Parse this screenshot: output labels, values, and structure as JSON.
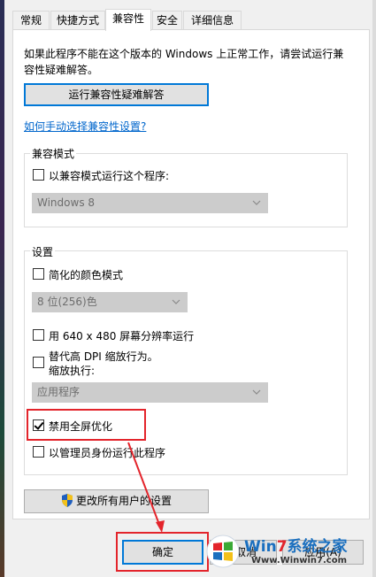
{
  "tabs": [
    {
      "label": "常规"
    },
    {
      "label": "快捷方式"
    },
    {
      "label": "兼容性"
    },
    {
      "label": "安全"
    },
    {
      "label": "详细信息"
    }
  ],
  "active_tab": "兼容性",
  "intro_text": "如果此程序不能在这个版本的 Windows 上正常工作，请尝试运行兼容性疑难解答。",
  "run_troubleshooter_button": "运行兼容性疑难解答",
  "manual_link": "如何手动选择兼容性设置?",
  "compat_mode": {
    "title": "兼容模式",
    "checkbox_label": "以兼容模式运行这个程序:",
    "checked": false,
    "select_value": "Windows 8"
  },
  "settings": {
    "title": "设置",
    "reduced_color": {
      "label": "简化的颜色模式",
      "checked": false
    },
    "color_select_value": "8 位(256)色",
    "run_640": {
      "label": "用 640 x 480 屏幕分辨率运行",
      "checked": false
    },
    "dpi_override": {
      "label_line1": "替代高 DPI 缩放行为。",
      "label_line2": "缩放执行:",
      "checked": false
    },
    "dpi_select_value": "应用程序",
    "disable_fullscreen": {
      "label": "禁用全屏优化",
      "checked": true
    },
    "run_as_admin": {
      "label": "以管理员身份运行此程序",
      "checked": false
    }
  },
  "change_all_users_button": "更改所有用户的设置",
  "footer": {
    "ok_label": "确定",
    "cancel_label": "取消",
    "apply_label": "应用(A)"
  },
  "watermark": {
    "brand_prefix": "Win",
    "brand_number": "7",
    "brand_suffix": "系统之家",
    "url": "Www.Winwin7.com"
  },
  "colors": {
    "highlight": "#e3242b",
    "link": "#0066cc",
    "focus_border": "#0078d7"
  }
}
